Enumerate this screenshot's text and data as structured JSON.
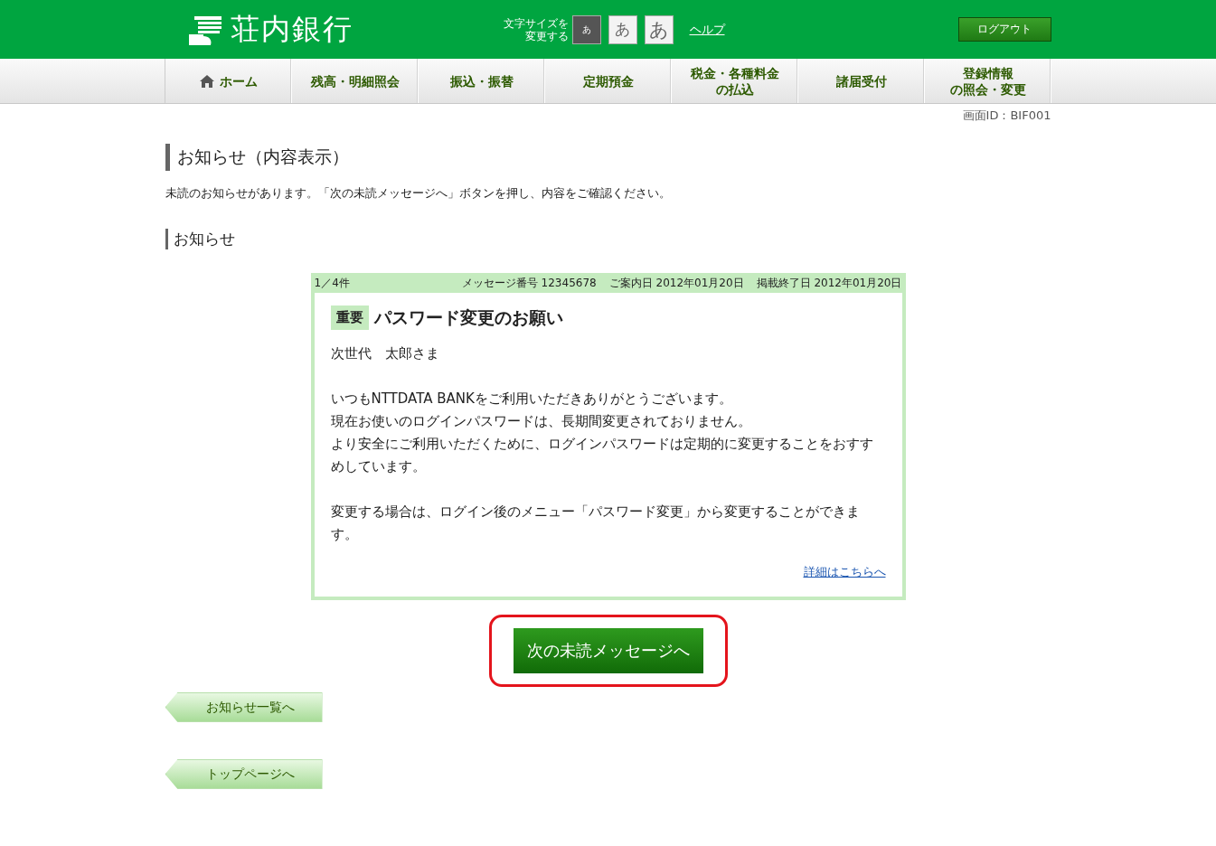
{
  "header": {
    "logo": "荘内銀行",
    "font_size_label": [
      "文字サイズを",
      "変更する"
    ],
    "font_sizes": [
      {
        "label": "あ",
        "selected": true
      },
      {
        "label": "あ",
        "selected": false
      },
      {
        "label": "あ",
        "selected": false
      }
    ],
    "help": "ヘルプ",
    "logout": "ログアウト"
  },
  "nav": [
    {
      "lines": [
        "ホーム"
      ],
      "kind": "home"
    },
    {
      "lines": [
        "残高・明細照会"
      ],
      "kind": "plain"
    },
    {
      "lines": [
        "振込・振替"
      ],
      "kind": "plain"
    },
    {
      "lines": [
        "定期預金"
      ],
      "kind": "plain"
    },
    {
      "lines": [
        "税金・各種料金",
        "の払込"
      ],
      "kind": "plain"
    },
    {
      "lines": [
        "諸届受付"
      ],
      "kind": "plain"
    },
    {
      "lines": [
        "登録情報",
        "の照会・変更"
      ],
      "kind": "plain"
    }
  ],
  "screen_id": "画面ID：BIF001",
  "page_title": "お知らせ（内容表示）",
  "intro": "未読のお知らせがあります。「次の未読メッセージへ」ボタンを押し、内容をご確認ください。",
  "section_title": "お知らせ",
  "message": {
    "count": "1／4件",
    "number": "メッセージ番号 12345678",
    "notice_date": "ご案内日 2012年01月20日",
    "end_date": "掲載終了日 2012年01月20日",
    "tag": "重要",
    "title": "パスワード変更のお願い",
    "paragraphs": [
      [
        "次世代　太郎さま"
      ],
      [
        "いつもNTTDATA BANKをご利用いただきありがとうございます。",
        "現在お使いのログインパスワードは、長期間変更されておりません。",
        "より安全にご利用いただくために、ログインパスワードは定期的に変更することをおすすめしています。"
      ],
      [
        "変更する場合は、ログイン後のメニュー「パスワード変更」から変更することができます。"
      ]
    ],
    "link": "詳細はこちらへ"
  },
  "next_button": {
    "label": "次の未読メッセージへ",
    "highlighted": true
  },
  "back_buttons": [
    "お知らせ一覧へ",
    "トップページへ"
  ]
}
